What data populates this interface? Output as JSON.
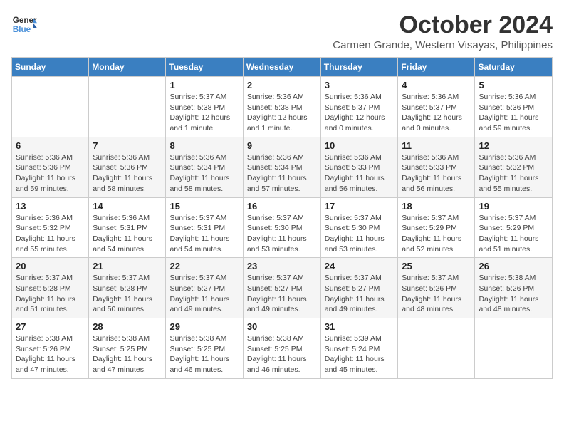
{
  "header": {
    "logo_line1": "General",
    "logo_line2": "Blue",
    "month_title": "October 2024",
    "subtitle": "Carmen Grande, Western Visayas, Philippines"
  },
  "weekdays": [
    "Sunday",
    "Monday",
    "Tuesday",
    "Wednesday",
    "Thursday",
    "Friday",
    "Saturday"
  ],
  "weeks": [
    [
      {
        "day": "",
        "info": ""
      },
      {
        "day": "",
        "info": ""
      },
      {
        "day": "1",
        "info": "Sunrise: 5:37 AM\nSunset: 5:38 PM\nDaylight: 12 hours and 1 minute."
      },
      {
        "day": "2",
        "info": "Sunrise: 5:36 AM\nSunset: 5:38 PM\nDaylight: 12 hours and 1 minute."
      },
      {
        "day": "3",
        "info": "Sunrise: 5:36 AM\nSunset: 5:37 PM\nDaylight: 12 hours and 0 minutes."
      },
      {
        "day": "4",
        "info": "Sunrise: 5:36 AM\nSunset: 5:37 PM\nDaylight: 12 hours and 0 minutes."
      },
      {
        "day": "5",
        "info": "Sunrise: 5:36 AM\nSunset: 5:36 PM\nDaylight: 11 hours and 59 minutes."
      }
    ],
    [
      {
        "day": "6",
        "info": "Sunrise: 5:36 AM\nSunset: 5:36 PM\nDaylight: 11 hours and 59 minutes."
      },
      {
        "day": "7",
        "info": "Sunrise: 5:36 AM\nSunset: 5:36 PM\nDaylight: 11 hours and 58 minutes."
      },
      {
        "day": "8",
        "info": "Sunrise: 5:36 AM\nSunset: 5:34 PM\nDaylight: 11 hours and 58 minutes."
      },
      {
        "day": "9",
        "info": "Sunrise: 5:36 AM\nSunset: 5:34 PM\nDaylight: 11 hours and 57 minutes."
      },
      {
        "day": "10",
        "info": "Sunrise: 5:36 AM\nSunset: 5:33 PM\nDaylight: 11 hours and 56 minutes."
      },
      {
        "day": "11",
        "info": "Sunrise: 5:36 AM\nSunset: 5:33 PM\nDaylight: 11 hours and 56 minutes."
      },
      {
        "day": "12",
        "info": "Sunrise: 5:36 AM\nSunset: 5:32 PM\nDaylight: 11 hours and 55 minutes."
      }
    ],
    [
      {
        "day": "13",
        "info": "Sunrise: 5:36 AM\nSunset: 5:32 PM\nDaylight: 11 hours and 55 minutes."
      },
      {
        "day": "14",
        "info": "Sunrise: 5:36 AM\nSunset: 5:31 PM\nDaylight: 11 hours and 54 minutes."
      },
      {
        "day": "15",
        "info": "Sunrise: 5:37 AM\nSunset: 5:31 PM\nDaylight: 11 hours and 54 minutes."
      },
      {
        "day": "16",
        "info": "Sunrise: 5:37 AM\nSunset: 5:30 PM\nDaylight: 11 hours and 53 minutes."
      },
      {
        "day": "17",
        "info": "Sunrise: 5:37 AM\nSunset: 5:30 PM\nDaylight: 11 hours and 53 minutes."
      },
      {
        "day": "18",
        "info": "Sunrise: 5:37 AM\nSunset: 5:29 PM\nDaylight: 11 hours and 52 minutes."
      },
      {
        "day": "19",
        "info": "Sunrise: 5:37 AM\nSunset: 5:29 PM\nDaylight: 11 hours and 51 minutes."
      }
    ],
    [
      {
        "day": "20",
        "info": "Sunrise: 5:37 AM\nSunset: 5:28 PM\nDaylight: 11 hours and 51 minutes."
      },
      {
        "day": "21",
        "info": "Sunrise: 5:37 AM\nSunset: 5:28 PM\nDaylight: 11 hours and 50 minutes."
      },
      {
        "day": "22",
        "info": "Sunrise: 5:37 AM\nSunset: 5:27 PM\nDaylight: 11 hours and 49 minutes."
      },
      {
        "day": "23",
        "info": "Sunrise: 5:37 AM\nSunset: 5:27 PM\nDaylight: 11 hours and 49 minutes."
      },
      {
        "day": "24",
        "info": "Sunrise: 5:37 AM\nSunset: 5:27 PM\nDaylight: 11 hours and 49 minutes."
      },
      {
        "day": "25",
        "info": "Sunrise: 5:37 AM\nSunset: 5:26 PM\nDaylight: 11 hours and 48 minutes."
      },
      {
        "day": "26",
        "info": "Sunrise: 5:38 AM\nSunset: 5:26 PM\nDaylight: 11 hours and 48 minutes."
      }
    ],
    [
      {
        "day": "27",
        "info": "Sunrise: 5:38 AM\nSunset: 5:26 PM\nDaylight: 11 hours and 47 minutes."
      },
      {
        "day": "28",
        "info": "Sunrise: 5:38 AM\nSunset: 5:25 PM\nDaylight: 11 hours and 47 minutes."
      },
      {
        "day": "29",
        "info": "Sunrise: 5:38 AM\nSunset: 5:25 PM\nDaylight: 11 hours and 46 minutes."
      },
      {
        "day": "30",
        "info": "Sunrise: 5:38 AM\nSunset: 5:25 PM\nDaylight: 11 hours and 46 minutes."
      },
      {
        "day": "31",
        "info": "Sunrise: 5:39 AM\nSunset: 5:24 PM\nDaylight: 11 hours and 45 minutes."
      },
      {
        "day": "",
        "info": ""
      },
      {
        "day": "",
        "info": ""
      }
    ]
  ]
}
